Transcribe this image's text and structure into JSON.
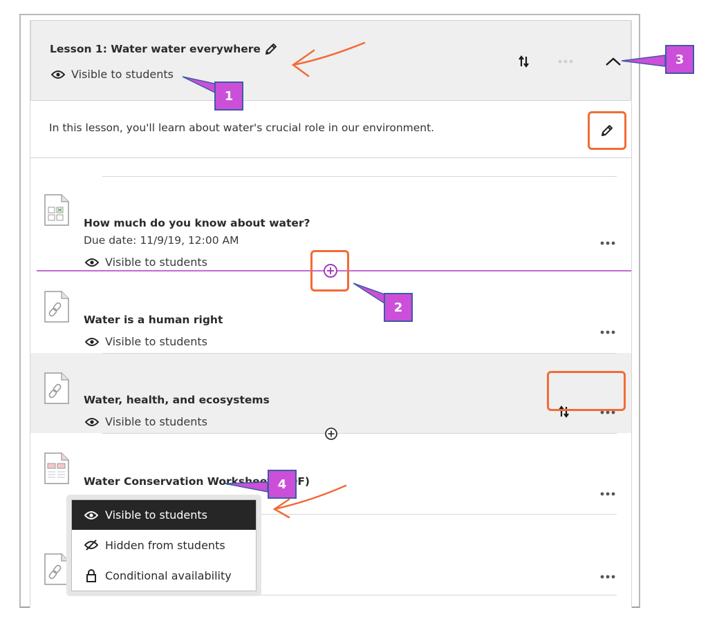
{
  "lesson": {
    "title": "Lesson 1: Water water everywhere",
    "visibility": "Visible to students",
    "description": "In this lesson, you'll learn about water's crucial role in our environment."
  },
  "header_icons": {
    "edit_title": "pencil-icon",
    "reorder": "sort-arrows-icon",
    "more": "more-dots-icon",
    "collapse": "chevron-up-icon"
  },
  "items": [
    {
      "title": "How much do you know about water?",
      "due": "Due date: 11/9/19, 12:00 AM",
      "visibility": "Visible to students",
      "icon": "test-file-icon"
    },
    {
      "title": "Water is a human right",
      "visibility": "Visible to students",
      "icon": "link-file-icon"
    },
    {
      "title": "Water, health, and ecosystems",
      "visibility": "Visible to students",
      "icon": "link-file-icon"
    },
    {
      "title": "Water Conservation Worksheet (PDF)",
      "visibility": "Visible to students",
      "icon": "pdf-file-icon"
    },
    {
      "title": "",
      "icon": "link-file-icon"
    }
  ],
  "visibility_menu": {
    "options": [
      {
        "label": "Visible to students",
        "icon": "eye-icon",
        "selected": true
      },
      {
        "label": "Hidden from students",
        "icon": "eye-slash-icon",
        "selected": false
      },
      {
        "label": "Conditional availability",
        "icon": "lock-icon",
        "selected": false
      }
    ]
  },
  "callouts": [
    "1",
    "2",
    "3",
    "4"
  ],
  "colors": {
    "callout_fill": "#cc4fd9",
    "callout_border": "#3e5ba3",
    "highlight_box": "#f26b36",
    "insert_line": "#c369d6",
    "header_bg": "#efefef",
    "menu_selected_bg": "#262626"
  }
}
